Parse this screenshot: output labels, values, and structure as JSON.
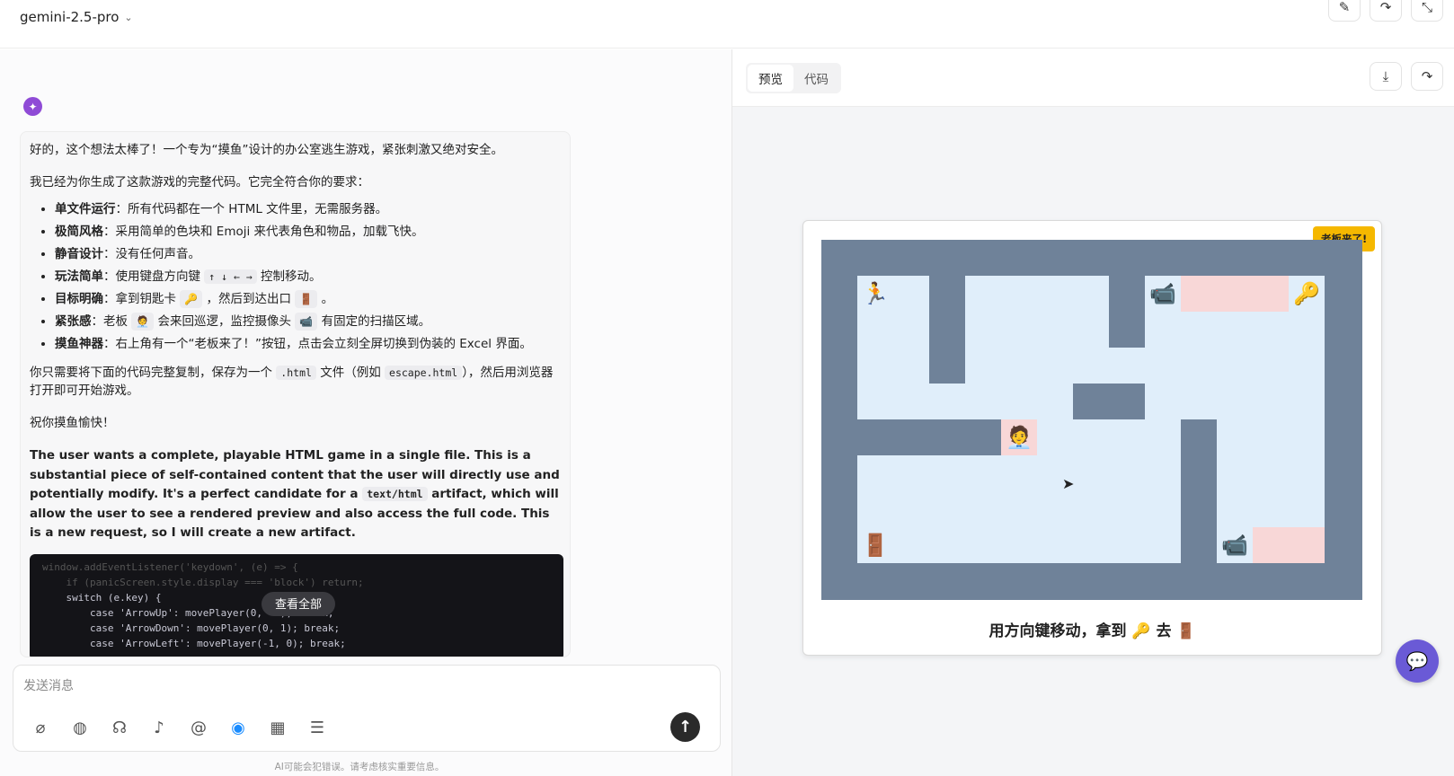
{
  "header": {
    "model": "gemini-2.5-pro"
  },
  "message": {
    "p1": "好的，这个想法太棒了！一个专为“摸鱼”设计的办公室逃生游戏，紧张刺激又绝对安全。",
    "p2": "我已经为你生成了这款游戏的完整代码。它完全符合你的要求：",
    "bullets": [
      {
        "head": "单文件运行",
        "text": "：所有代码都在一个 HTML 文件里，无需服务器。"
      },
      {
        "head": "极简风格",
        "text": "：采用简单的色块和 Emoji 来代表角色和物品，加载飞快。"
      },
      {
        "head": "静音设计",
        "text": "：没有任何声音。"
      },
      {
        "head": "玩法简单",
        "text_a": "：使用键盘方向键 ",
        "chip": "↑ ↓ ← →",
        "text_b": " 控制移动。"
      },
      {
        "head": "目标明确",
        "text_a": "：拿到钥匙卡 ",
        "chip": "🔑",
        "text_b": " ，然后到达出口 ",
        "chip2": "🚪",
        "text_c": " 。"
      },
      {
        "head": "紧张感",
        "text_a": "：老板 ",
        "chip": "🧑‍💼",
        "text_b": " 会来回巡逻，监控摄像头 ",
        "chip2": "📹",
        "text_c": " 有固定的扫描区域。"
      },
      {
        "head": "摸鱼神器",
        "text": "：右上角有一个“老板来了！”按钮，点击会立刻全屏切换到伪装的 Excel 界面。"
      }
    ],
    "p3_a": "你只需要将下面的代码完整复制，保存为一个 ",
    "p3_code1": ".html",
    "p3_b": " 文件（例如 ",
    "p3_code2": "escape.html",
    "p3_c": "），然后用浏览器打开即可开始游戏。",
    "p4": "祝你摸鱼愉快！",
    "eng_a": "The user wants a complete, playable HTML game in a single file. This is a substantial piece of self-contained content that the user will directly use and potentially modify. It's a perfect candidate for a ",
    "eng_code": "text/html",
    "eng_b": " artifact, which will allow the user to see a rendered preview and also access the full code. This is a new request, so I will create a new artifact.",
    "code_lines": [
      "window.addEventListener('keydown', (e) => {",
      "    if (panicScreen.style.display === 'block') return;",
      "    switch (e.key) {",
      "        case 'ArrowUp': movePlayer(0, -1); break;",
      "        case 'ArrowDown': movePlayer(0, 1); break;",
      "        case 'ArrowLeft': movePlayer(-1, 0); break;"
    ],
    "see_all": "查看全部"
  },
  "composer": {
    "placeholder": "发送消息",
    "disclaimer": "AI可能会犯错误。请考虑核实重要信息。"
  },
  "preview": {
    "tabs": [
      "预览",
      "代码"
    ],
    "boss_button": "老板来了!",
    "caption": "用方向键移动，拿到 🔑 去 🚪",
    "icons": {
      "player": "🏃",
      "camera": "📹",
      "key": "🔑",
      "boss": "🧑‍💼",
      "door": "🚪"
    }
  },
  "colors": {
    "wall": "#6f8299",
    "floor": "#e0eefa",
    "scan": "#f8d7d7",
    "boss_btn": "#f5b800",
    "fab": "#6a5ad6"
  }
}
